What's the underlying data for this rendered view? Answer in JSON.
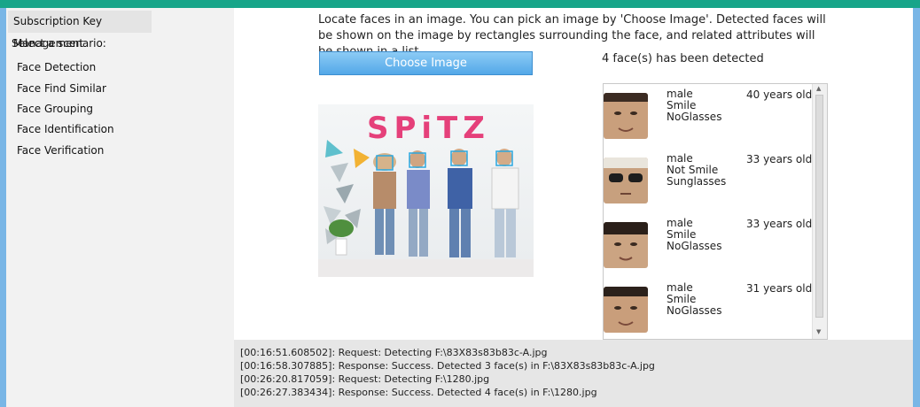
{
  "sidebar": {
    "tab_label": "Subscription Key Management",
    "scenario_label": "Select a scenario:",
    "items": [
      {
        "label": "Face Detection"
      },
      {
        "label": "Face Find Similar"
      },
      {
        "label": "Face Grouping"
      },
      {
        "label": "Face Identification"
      },
      {
        "label": "Face Verification"
      }
    ]
  },
  "main": {
    "description": "Locate faces in an image. You can pick an image by 'Choose Image'. Detected faces will be shown on the image by rectangles surrounding the face, and related attributes will be shown in a list.",
    "choose_button_label": "Choose Image",
    "detected_text": "4 face(s) has been detected",
    "photo": {
      "logo_text": "SPiTZ"
    },
    "faces": [
      {
        "gender": "male",
        "smile": "Smile",
        "glasses": "NoGlasses",
        "age": "40 years old"
      },
      {
        "gender": "male",
        "smile": "Not Smile",
        "glasses": "Sunglasses",
        "age": "33 years old"
      },
      {
        "gender": "male",
        "smile": "Smile",
        "glasses": "NoGlasses",
        "age": "33 years old"
      },
      {
        "gender": "male",
        "smile": "Smile",
        "glasses": "NoGlasses",
        "age": "31 years old"
      }
    ]
  },
  "log": {
    "lines": [
      "[00:16:51.608502]: Request: Detecting F:\\83X83s83b83c-A.jpg",
      "[00:16:58.307885]: Response: Success. Detected 3 face(s) in F:\\83X83s83b83c-A.jpg",
      "[00:26:20.817059]: Request: Detecting F:\\1280.jpg",
      "[00:26:27.383434]: Response: Success. Detected 4 face(s) in F:\\1280.jpg"
    ]
  },
  "colors": {
    "title_bar": "#17a589",
    "button": "#5aaeea",
    "face_box": "#2aa8e0"
  }
}
